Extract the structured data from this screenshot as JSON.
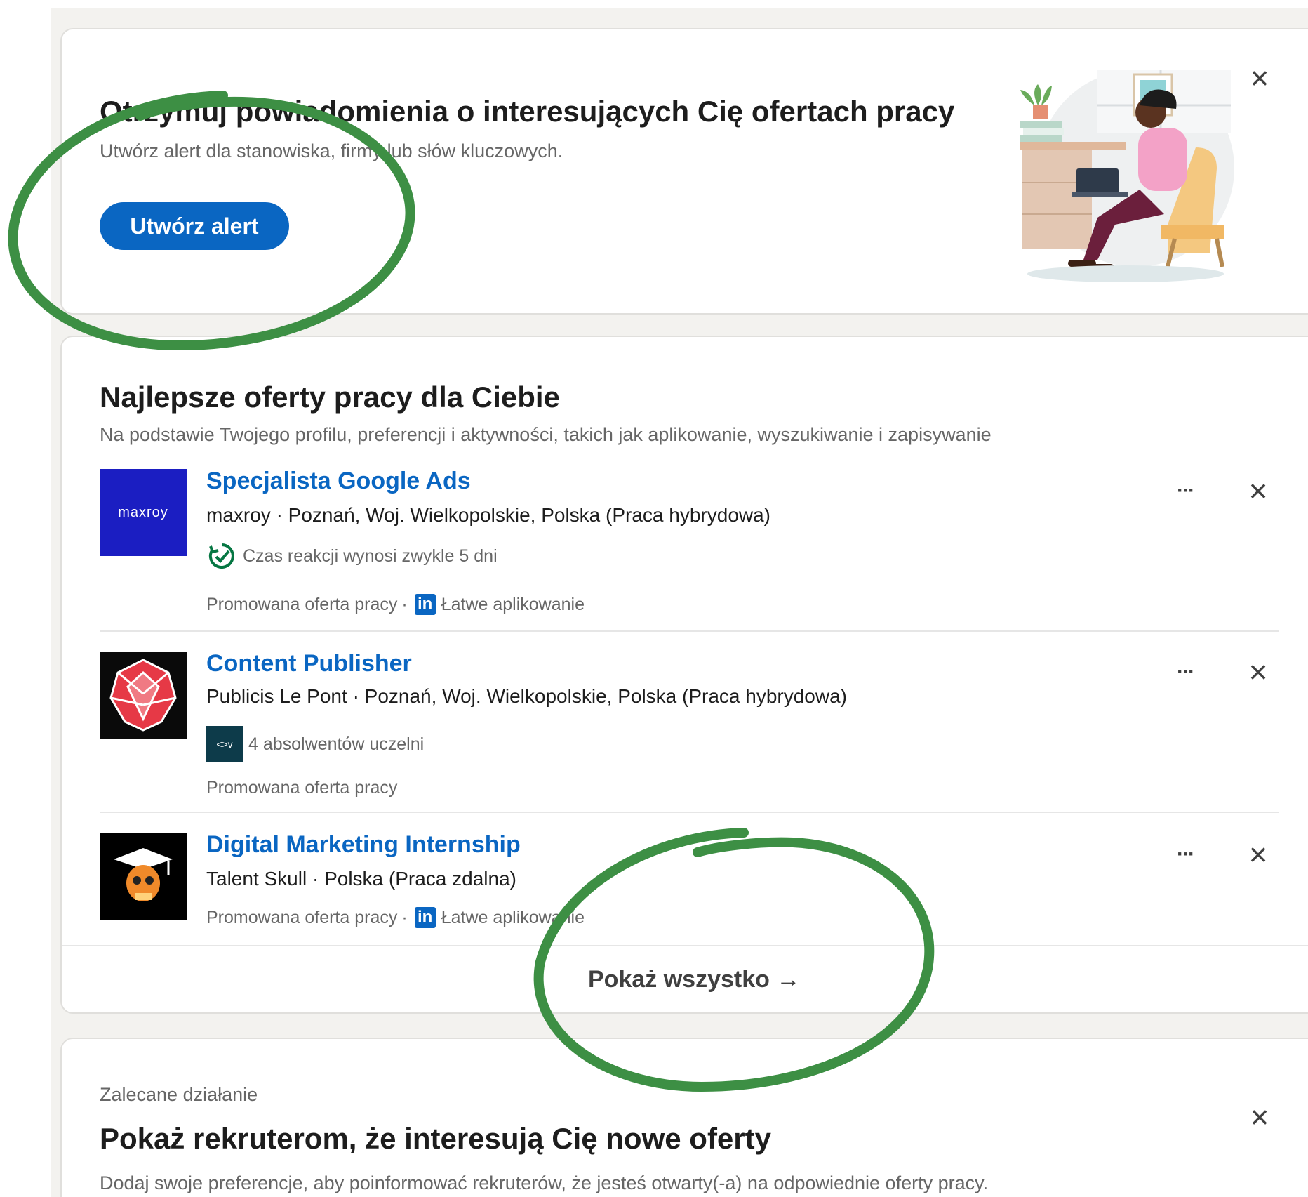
{
  "alert_card": {
    "title": "Otrzymuj powiadomienia o interesujących Cię ofertach pracy",
    "subtitle": "Utwórz alert dla stanowiska, firmy lub słów kluczowych.",
    "button_label": "Utwórz alert",
    "close_icon": "×"
  },
  "jobs_card": {
    "title": "Najlepsze oferty pracy dla Ciebie",
    "subtitle": "Na podstawie Twojego profilu, preferencji i aktywności, takich jak aplikowanie, wyszukiwanie i zapisywanie",
    "jobs": [
      {
        "title": "Specjalista Google Ads",
        "company": "maxroy",
        "meta": "maxroy · Poznań, Woj. Wielkopolskie, Polska (Praca hybrydowa)",
        "insight": "Czas reakcji wynosi zwykle 5 dni",
        "promoted": "Promowana oferta pracy",
        "easy_apply": "Łatwe aplikowanie",
        "logo_text": "maxroy"
      },
      {
        "title": "Content Publisher",
        "company": "Publicis Le Pont",
        "meta": "Publicis Le Pont · Poznań, Woj. Wielkopolskie, Polska (Praca hybrydowa)",
        "insight": "4 absolwentów uczelni",
        "insight_logo": "<>v",
        "promoted": "Promowana oferta pracy"
      },
      {
        "title": "Digital Marketing Internship",
        "company": "Talent Skull",
        "meta": "Talent Skull · Polska (Praca zdalna)",
        "promoted": "Promowana oferta pracy",
        "easy_apply": "Łatwe aplikowanie"
      }
    ],
    "show_all": "Pokaż wszystko →",
    "dots": "···",
    "close_icon": "×",
    "li_badge": "in",
    "separator": "·"
  },
  "recommend_card": {
    "eyebrow": "Zalecane działanie",
    "title": "Pokaż rekruterom, że interesują Cię nowe oferty",
    "subtitle": "Dodaj swoje preferencje, aby poinformować rekruterów, że jesteś otwarty(-a) na odpowiednie oferty pracy.",
    "close_icon": "×"
  },
  "colors": {
    "accent": "#0a66c2",
    "annotation": "#3d8f44",
    "background": "#f3f2ef"
  }
}
